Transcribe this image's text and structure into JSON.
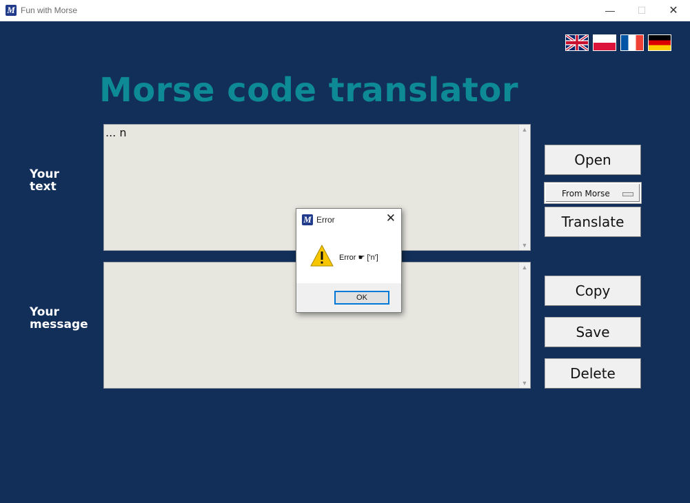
{
  "window": {
    "app_icon_letter": "M",
    "title": "Fun with Morse",
    "controls": {
      "minimize": "—",
      "maximize": "☐",
      "close": "✕"
    }
  },
  "languages": [
    {
      "code": "en",
      "name": "English"
    },
    {
      "code": "pl",
      "name": "Polish"
    },
    {
      "code": "fr",
      "name": "French"
    },
    {
      "code": "de",
      "name": "German"
    }
  ],
  "main": {
    "title": "Morse code translator",
    "input_label": "Your\ntext",
    "input_value": "... n",
    "output_label": "Your\nmessage",
    "output_value": ""
  },
  "buttons": {
    "open": "Open",
    "translate": "Translate",
    "copy": "Copy",
    "save": "Save",
    "delete": "Delete"
  },
  "mode_select": {
    "selected": "From Morse"
  },
  "dialog": {
    "icon_letter": "M",
    "title": "Error",
    "message": "Error ☛ ['n']",
    "ok_label": "OK",
    "close": "✕"
  },
  "colors": {
    "background": "#112f58",
    "title": "#0d8a96",
    "textarea": "#e8e7df"
  }
}
